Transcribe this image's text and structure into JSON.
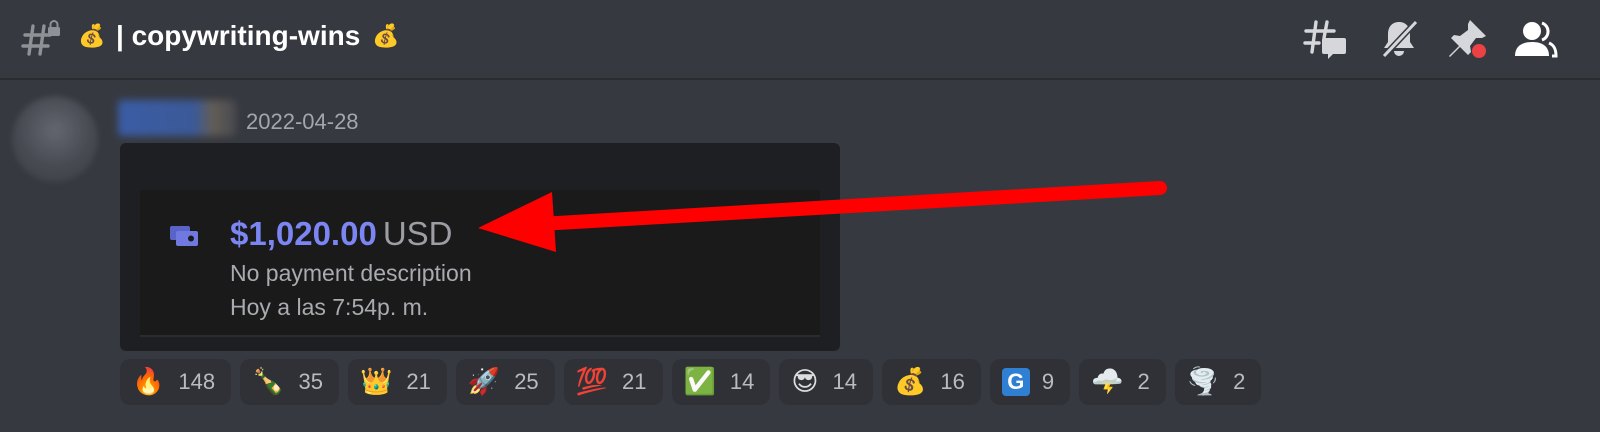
{
  "header": {
    "channel_prefix_emoji": "💰",
    "channel_name": "| copywriting-wins",
    "channel_suffix_emoji": "💰",
    "icons": [
      "threads-icon",
      "notifications-muted-icon",
      "pinned-messages-icon",
      "member-list-icon"
    ]
  },
  "message": {
    "timestamp": "2022-04-28",
    "embed": {
      "amount": "$1,020.00",
      "currency": "USD",
      "description": "No payment description",
      "time": "Hoy a las 7:54p. m."
    }
  },
  "reactions": [
    {
      "emoji": "🔥",
      "count": "148"
    },
    {
      "emoji": "🍾",
      "count": "35"
    },
    {
      "emoji": "👑",
      "count": "21"
    },
    {
      "emoji": "🚀",
      "count": "25"
    },
    {
      "emoji": "💯",
      "count": "21"
    },
    {
      "emoji": "✅",
      "count": "14"
    },
    {
      "emoji": "😎",
      "count": "14"
    },
    {
      "emoji": "💰",
      "count": "16"
    },
    {
      "emoji": "G",
      "count": "9"
    },
    {
      "emoji": "🌩️",
      "count": "2"
    },
    {
      "emoji": "🌪️",
      "count": "2"
    }
  ],
  "colors": {
    "background": "#36393f",
    "accent_amount": "#7b86f3",
    "arrow": "#ff0000",
    "notification_dot": "#ed4245"
  }
}
